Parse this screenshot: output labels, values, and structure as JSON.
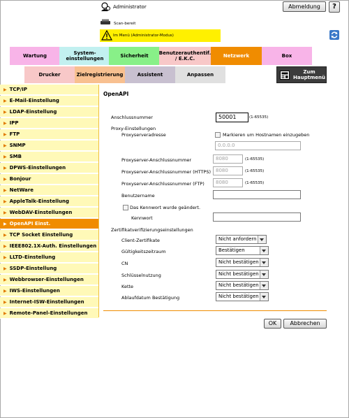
{
  "header": {
    "admin_label": "Administrator",
    "logout_label": "Abmeldung",
    "help_label": "?",
    "scan_status": "Scan-bereit",
    "mode_text": "Im Menü (Administrator-Modus)"
  },
  "tabs_row1": [
    {
      "label": "Wartung",
      "color": "#f8b4e8"
    },
    {
      "label": "System-\neinstellungen",
      "color": "#c2f0f0"
    },
    {
      "label": "Sicherheit",
      "color": "#88f088"
    },
    {
      "label": "Benutzerauthentif. / E.K.C.",
      "color": "#f8c8c8"
    },
    {
      "label": "Netzwerk",
      "color": "#f08c00"
    },
    {
      "label": "Box",
      "color": "#f8b4e8"
    }
  ],
  "tabs_row2": [
    {
      "label": "Drucker",
      "color": "#f8c8c8"
    },
    {
      "label": "Zielregistrierung",
      "color": "#f8c090"
    },
    {
      "label": "Assistent",
      "color": "#c8c0d0"
    },
    {
      "label": "Anpassen",
      "color": "#e0e0e0"
    }
  ],
  "home_button": "Zum\nHauptmenü",
  "sidebar": [
    "TCP/IP",
    "E-Mail-Einstellung",
    "LDAP-Einstellung",
    "IPP",
    "FTP",
    "SNMP",
    "SMB",
    "DPWS-Einstellungen",
    "Bonjour",
    "NetWare",
    "AppleTalk-Einstellung",
    "WebDAV-Einstellungen",
    "OpenAPI Einst.",
    "TCP Socket Einstellung",
    "IEEE802.1X-Auth. Einstellungen",
    "LLTD-Einstellung",
    "SSDP-Einstellung",
    "Webbrowser-Einstellungen",
    "IWS-Einstellungen",
    "Internet-ISW-Einstellungen",
    "Remote-Panel-Einstellungen"
  ],
  "sidebar_active": "OpenAPI Einst.",
  "form": {
    "title": "OpenAPI",
    "port_label": "Anschlussnummer",
    "port_value": "50001",
    "port_range": "(1-65535)",
    "proxy_section": "Proxy-Einstellungen",
    "proxy_address_label": "Proxyserveradresse",
    "hostname_checkbox_label": "Markieren um Hostnamen einzugeben",
    "proxy_address_value": "0.0.0.0",
    "proxy_port_label": "Proxyserver-Anschlussnummer",
    "proxy_port_value": "8080",
    "proxy_port_https_label": "Proxyserver-Anschlussnummer (HTTPS)",
    "proxy_port_https_value": "8080",
    "proxy_port_ftp_label": "Proxyserver-Anschlussnummer (FTP)",
    "proxy_port_ftp_value": "8080",
    "range_hint": "(1-65535)",
    "username_label": "Benutzername",
    "password_changed_label": "Das Kennwort wurde geändert.",
    "password_label": "Kennwort",
    "cert_section": "Zertifikatverifizierungseinstellungen",
    "client_cert_label": "Client-Zertifikate",
    "client_cert_value": "Nicht anfordern",
    "validity_label": "Gültigkeitszeitraum",
    "validity_value": "Bestätigen",
    "cn_label": "CN",
    "cn_value": "Nicht bestätigen",
    "key_usage_label": "Schlüsselnutzung",
    "key_usage_value": "Nicht bestätigen",
    "chain_label": "Kette",
    "chain_value": "Nicht bestätigen",
    "expiry_label": "Ablaufdatum Bestätigung",
    "expiry_value": "Nicht bestätigen",
    "ok_label": "OK",
    "cancel_label": "Abbrechen"
  },
  "colors": {
    "accent": "#f08c00",
    "sidebar_bg": "#fff9b8",
    "warning": "#fff000"
  }
}
